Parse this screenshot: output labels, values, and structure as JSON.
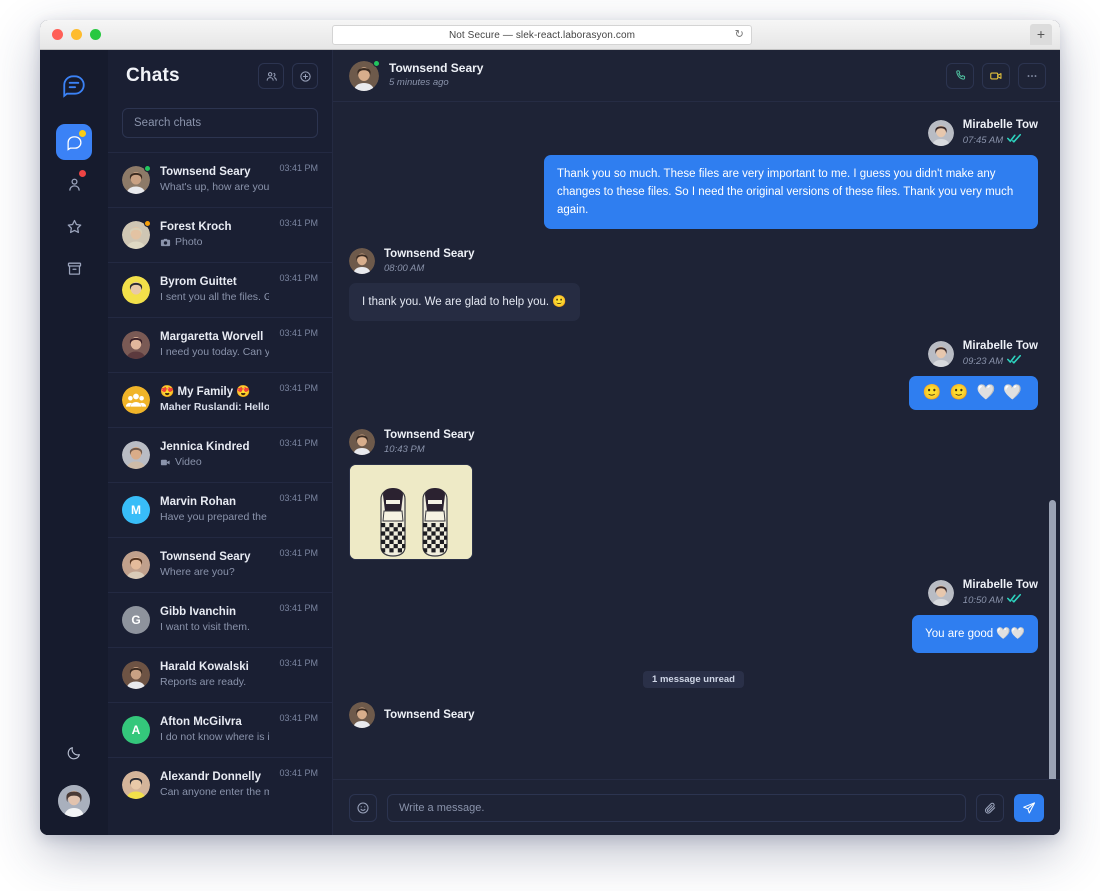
{
  "browser": {
    "url_text": "Not Secure — slek-react.laborasyon.com",
    "reload_icon": "reload-icon",
    "new_tab_icon": "plus-icon",
    "traffic_lights": [
      "close",
      "minimize",
      "maximize"
    ]
  },
  "rail": {
    "logo_icon": "chat-logo-icon",
    "items": [
      {
        "name": "chats",
        "icon": "chat-bubble-icon",
        "active": true,
        "badge": "yellow"
      },
      {
        "name": "contacts",
        "icon": "person-icon",
        "active": false,
        "badge": "red"
      },
      {
        "name": "favorites",
        "icon": "star-icon",
        "active": false,
        "badge": null
      },
      {
        "name": "archive",
        "icon": "archive-icon",
        "active": false,
        "badge": null
      }
    ],
    "theme_toggle_icon": "moon-icon",
    "profile_avatar": "user-avatar"
  },
  "chat_list": {
    "title": "Chats",
    "actions": [
      {
        "name": "contacts-button",
        "icon": "people-icon"
      },
      {
        "name": "new-chat-button",
        "icon": "plus-circle-icon"
      }
    ],
    "search": {
      "placeholder": "Search chats",
      "value": ""
    },
    "items": [
      {
        "name": "Townsend Seary",
        "preview": "What's up, how are you?",
        "time": "03:41 PM",
        "presence": "online",
        "avatar_kind": "photo",
        "avatar_color": "#8d7a68",
        "initial": "",
        "unread": false,
        "media": null
      },
      {
        "name": "Forest Kroch",
        "preview": "Photo",
        "time": "03:41 PM",
        "presence": "away",
        "avatar_kind": "photo",
        "avatar_color": "#cfc6b4",
        "initial": "",
        "unread": false,
        "media": "camera-icon"
      },
      {
        "name": "Byrom Guittet",
        "preview": "I sent you all the files. G...",
        "time": "03:41 PM",
        "presence": null,
        "avatar_kind": "photo",
        "avatar_color": "#f2e04a",
        "initial": "",
        "unread": false,
        "media": null
      },
      {
        "name": "Margaretta Worvell",
        "preview": "I need you today. Can y...",
        "time": "03:41 PM",
        "presence": null,
        "avatar_kind": "photo",
        "avatar_color": "#7a5a55",
        "initial": "",
        "unread": false,
        "media": null
      },
      {
        "name": "😍 My Family 😍",
        "preview": "Maher Ruslandi: Hello!!!",
        "time": "03:41 PM",
        "presence": null,
        "avatar_kind": "group",
        "avatar_color": "#f0b429",
        "initial": "",
        "unread": true,
        "media": null
      },
      {
        "name": "Jennica Kindred",
        "preview": "Video",
        "time": "03:41 PM",
        "presence": null,
        "avatar_kind": "photo",
        "avatar_color": "#b9bcc4",
        "initial": "",
        "unread": false,
        "media": "video-icon"
      },
      {
        "name": "Marvin Rohan",
        "preview": "Have you prepared the f...",
        "time": "03:41 PM",
        "presence": null,
        "avatar_kind": "initial",
        "avatar_color": "#38bdf8",
        "initial": "M",
        "unread": false,
        "media": null
      },
      {
        "name": "Townsend Seary",
        "preview": "Where are you?",
        "time": "03:41 PM",
        "presence": null,
        "avatar_kind": "photo",
        "avatar_color": "#c0a08c",
        "initial": "",
        "unread": false,
        "media": null
      },
      {
        "name": "Gibb Ivanchin",
        "preview": "I want to visit them.",
        "time": "03:41 PM",
        "presence": null,
        "avatar_kind": "initial",
        "avatar_color": "#8e939d",
        "initial": "G",
        "unread": false,
        "media": null
      },
      {
        "name": "Harald Kowalski",
        "preview": "Reports are ready.",
        "time": "03:41 PM",
        "presence": null,
        "avatar_kind": "photo",
        "avatar_color": "#6d5344",
        "initial": "",
        "unread": false,
        "media": null
      },
      {
        "name": "Afton McGilvra",
        "preview": "I do not know where is it...",
        "time": "03:41 PM",
        "presence": null,
        "avatar_kind": "initial",
        "avatar_color": "#34c77b",
        "initial": "A",
        "unread": false,
        "media": null
      },
      {
        "name": "Alexandr Donnelly",
        "preview": "Can anyone enter the m...",
        "time": "03:41 PM",
        "presence": null,
        "avatar_kind": "photo",
        "avatar_color": "#d4b49a",
        "initial": "",
        "unread": false,
        "media": null
      }
    ]
  },
  "conversation": {
    "header": {
      "name": "Townsend Seary",
      "status": "5 minutes ago",
      "presence": "online",
      "actions": [
        {
          "name": "voice-call-button",
          "icon": "phone-icon",
          "color": "#4fbf9f"
        },
        {
          "name": "video-call-button",
          "icon": "video-camera-icon",
          "color": "#e3c23c"
        },
        {
          "name": "more-options-button",
          "icon": "ellipsis-icon",
          "color": "#8a93ab"
        }
      ]
    },
    "messages": [
      {
        "id": "m1",
        "direction": "out",
        "sender": "Mirabelle Tow",
        "time": "07:45 AM",
        "read_receipt": "double-check",
        "type": "text",
        "text": "Thank you so much. These files are very important to me. I guess you didn't make any changes to these files. So I need the original versions of these files. Thank you very much again."
      },
      {
        "id": "m2",
        "direction": "in",
        "sender": "Townsend Seary",
        "time": "08:00 AM",
        "read_receipt": null,
        "type": "text",
        "text": "I thank you. We are glad to help you. 🙂"
      },
      {
        "id": "m3",
        "direction": "out",
        "sender": "Mirabelle Tow",
        "time": "09:23 AM",
        "read_receipt": "double-check",
        "type": "emoji",
        "text": "🙂 🙂 🤍 🤍"
      },
      {
        "id": "m4",
        "direction": "in",
        "sender": "Townsend Seary",
        "time": "10:43 PM",
        "read_receipt": null,
        "type": "image",
        "text": "",
        "image_alt": "checkered slip-on shoes photo"
      },
      {
        "id": "m5",
        "direction": "out",
        "sender": "Mirabelle Tow",
        "time": "10:50 AM",
        "read_receipt": "double-check",
        "type": "text",
        "text": "You are good 🤍🤍"
      }
    ],
    "unread_divider": "1 message unread",
    "partial_bottom_sender": "Townsend Seary",
    "composer": {
      "emoji_icon": "emoji-smiley-icon",
      "placeholder": "Write a message.",
      "value": "",
      "attach_icon": "paperclip-icon",
      "send_icon": "send-paper-plane-icon"
    }
  },
  "colors": {
    "accent_blue": "#2f7ef0",
    "rail_bg": "#161b2d",
    "list_bg": "#1a1f33",
    "conv_bg": "#1e2336",
    "bubble_in": "#262c42",
    "tick_teal": "#2dd4bf"
  }
}
